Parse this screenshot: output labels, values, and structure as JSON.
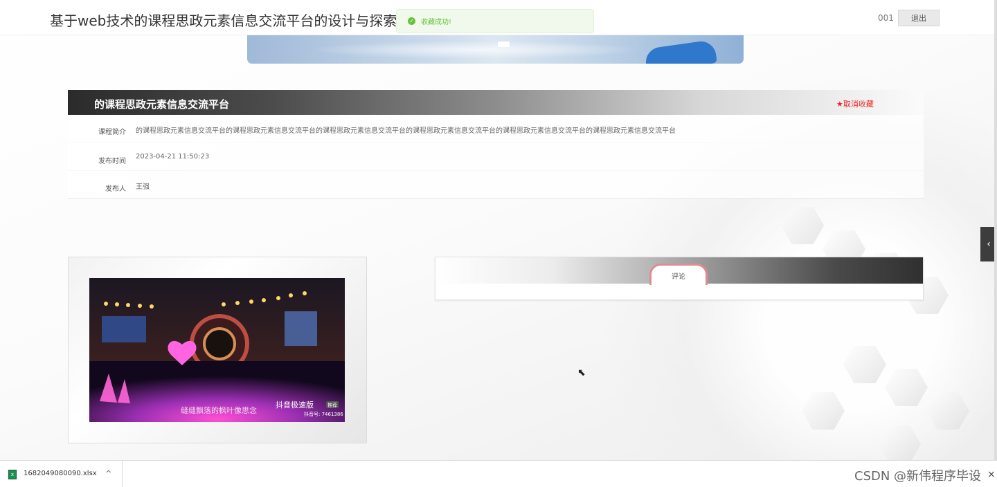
{
  "header": {
    "site_title": "基于web技术的课程思政元素信息交流平台的设计与探索",
    "user_name": "001",
    "logout_label": "退出"
  },
  "toast": {
    "message": "收藏成功!",
    "icon": "check-circle-icon"
  },
  "course": {
    "title": "的课程思政元素信息交流平台",
    "favorite_label": "★取消收藏",
    "fields": [
      {
        "label": "课程简介",
        "value": "的课程思政元素信息交流平台的课程思政元素信息交流平台的课程思政元素信息交流平台的课程思政元素信息交流平台的课程思政元素信息交流平台的课程思政元素信息交流平台"
      },
      {
        "label": "发布时间",
        "value": "2023-04-21 11:50:23"
      },
      {
        "label": "发布人",
        "value": "王强"
      }
    ]
  },
  "media": {
    "caption": "缝缝飘落的枫叶像思念",
    "brand": "抖音极速版",
    "brand_tag": "推荐",
    "id_text": "抖音号: 7461386"
  },
  "comments": {
    "tab_label": "评论"
  },
  "download_bar": {
    "file_name": "1682049080090.xlsx",
    "menu_icon": "^",
    "watermark": "CSDN @新伟程序毕设",
    "close_icon": "×"
  },
  "colors": {
    "success": "#67c23a",
    "favorite": "#e22222",
    "comment_tab_border": "#e28b94"
  }
}
